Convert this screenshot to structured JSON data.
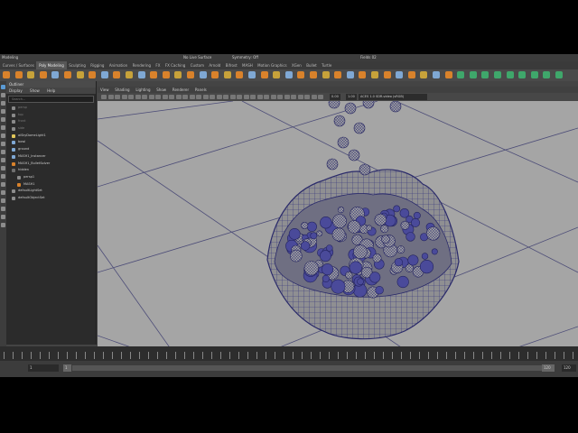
{
  "status_line": {
    "menu_set": "Modeling",
    "live_surface": "No Live Surface",
    "symmetry": "Symmetry: Off",
    "badge": "Fields 02"
  },
  "shelf": {
    "tabs": [
      "Curves / Surfaces",
      "Poly Modeling",
      "Sculpting",
      "Rigging",
      "Animation",
      "Rendering",
      "FX",
      "FX Caching",
      "Custom",
      "Arnold",
      "Bifrost",
      "MASH",
      "Motion Graphics",
      "XGen",
      "Bullet",
      "Turtle"
    ],
    "active_tab": "Poly Modeling"
  },
  "outliner": {
    "title": "Outliner",
    "menus": [
      "Display",
      "Show",
      "Help"
    ],
    "search_placeholder": "Search...",
    "items": [
      {
        "label": "persp",
        "dim": true
      },
      {
        "label": "top",
        "dim": true
      },
      {
        "label": "front",
        "dim": true
      },
      {
        "label": "side",
        "dim": true
      },
      {
        "label": "aiSkyDomeLight1",
        "dim": false
      },
      {
        "label": "bowl",
        "dim": false
      },
      {
        "label": "ground",
        "dim": false
      },
      {
        "label": "MASH1_Instancer",
        "dim": false
      },
      {
        "label": "MASH1_BulletSolver",
        "dim": false
      },
      {
        "label": "hidden",
        "dim": false
      },
      {
        "label": "persp1",
        "dim": false
      },
      {
        "label": "MASH1",
        "dim": false
      },
      {
        "label": "defaultLightSet",
        "dim": false
      },
      {
        "label": "defaultObjectSet",
        "dim": false
      }
    ]
  },
  "viewport": {
    "menus": [
      "View",
      "Shading",
      "Lighting",
      "Show",
      "Renderer",
      "Panels"
    ],
    "camera_label": "persp1",
    "colorspace": "ACES 1.0 SDR-video (sRGB)",
    "field_a": "0.00",
    "field_b": "1.00"
  },
  "range": {
    "start": "1",
    "inner_start": "1",
    "inner_end": "120",
    "end": "120"
  },
  "colors": {
    "viewport_bg": "#a5a5a5",
    "mesh_fill": "#8a8a8a",
    "wire": "#3a3a8c",
    "accent": "#5b9bd5"
  }
}
